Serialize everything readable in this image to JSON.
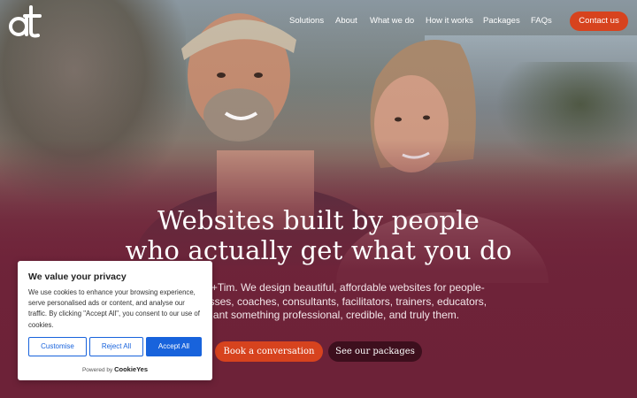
{
  "brand": {
    "logo_text": "at",
    "logo_color": "#ffffff"
  },
  "nav": {
    "items": [
      {
        "label": "Solutions"
      },
      {
        "label": "About"
      },
      {
        "label": "What we do"
      },
      {
        "label": "How it works"
      },
      {
        "label": "Packages"
      },
      {
        "label": "FAQs"
      }
    ],
    "contact_label": "Contact us"
  },
  "hero": {
    "headline_line1": "Websites built by people",
    "headline_line2": "who actually get what you do",
    "intro_line1": "a+Tim. We design beautiful, affordable websites for people-",
    "intro_line2": "esses, coaches, consultants, facilitators, trainers, educators,",
    "intro_line3": "ant something professional, credible, and truly them.",
    "cta_primary": "Book a conversation",
    "cta_secondary": "See our packages"
  },
  "cookie_banner": {
    "title": "We value your privacy",
    "body": "We use cookies to enhance your browsing experience, serve personalised ads or content, and analyse our traffic. By clicking \"Accept All\", you consent to our use of cookies.",
    "customise_label": "Customise",
    "reject_label": "Reject All",
    "accept_label": "Accept All",
    "powered_by": "Powered by",
    "powered_brand": "CookieYes"
  },
  "colors": {
    "accent": "#d7431e",
    "maroon": "#6e2339",
    "dark_maroon": "#3d0f1d",
    "cookie_blue": "#1863dc"
  }
}
